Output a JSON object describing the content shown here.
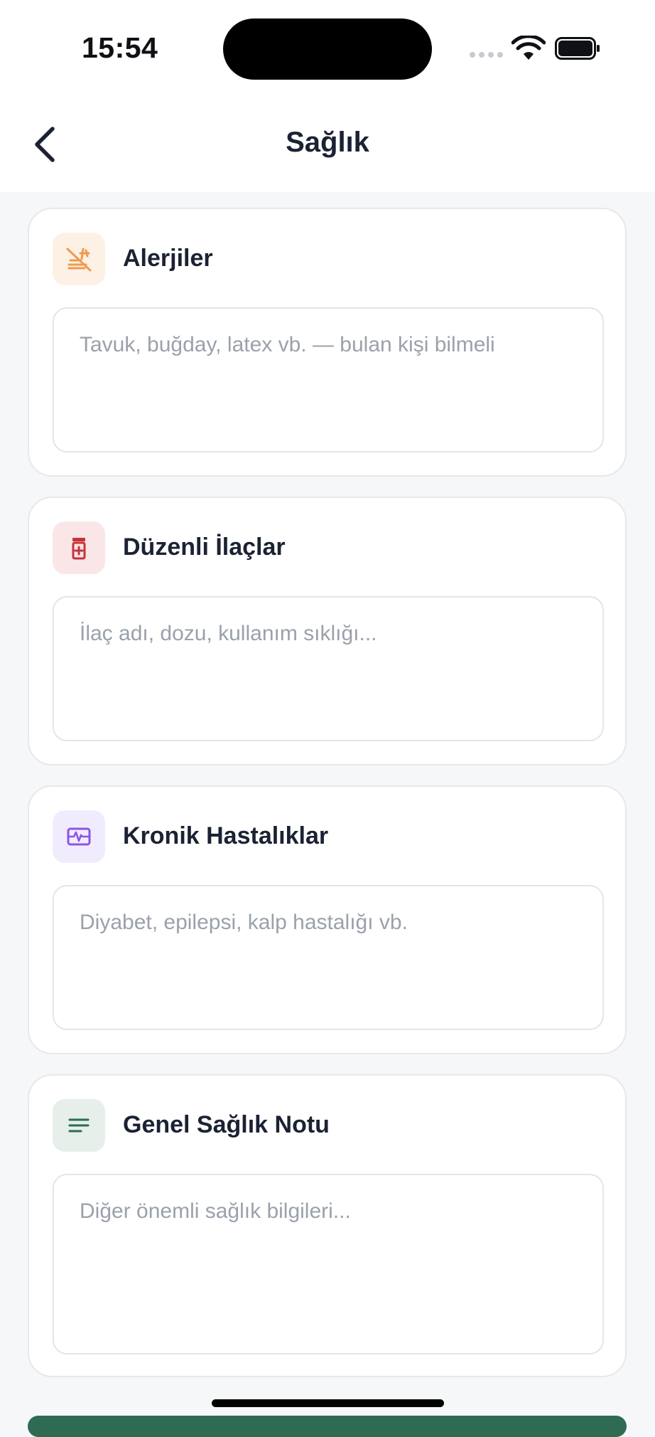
{
  "status_bar": {
    "time": "15:54"
  },
  "header": {
    "title": "Sağlık"
  },
  "sections": [
    {
      "id": "alerjiler",
      "title": "Alerjiler",
      "icon": "no-food-icon",
      "icon_color": "#EE9A4E",
      "icon_bg": "#FDF1E6",
      "placeholder": "Tavuk, buğday, latex vb. — bulan kişi bilmeli"
    },
    {
      "id": "ilaclar",
      "title": "Düzenli İlaçlar",
      "icon": "medication-icon",
      "icon_color": "#C7323B",
      "icon_bg": "#FBE6E7",
      "placeholder": "İlaç adı, dozu, kullanım sıklığı..."
    },
    {
      "id": "kronik",
      "title": "Kronik Hastalıklar",
      "icon": "monitor-heart-icon",
      "icon_color": "#8A55E6",
      "icon_bg": "#F1ECFD",
      "placeholder": "Diyabet, epilepsi, kalp hastalığı vb."
    },
    {
      "id": "genel",
      "title": "Genel Sağlık Notu",
      "icon": "notes-icon",
      "icon_color": "#2E6B52",
      "icon_bg": "#E6EFEA",
      "placeholder": "Diğer önemli sağlık bilgileri..."
    }
  ],
  "theme": {
    "primary": "#2E6B52",
    "text": "#1B2233",
    "placeholder": "#9AA1AB"
  }
}
